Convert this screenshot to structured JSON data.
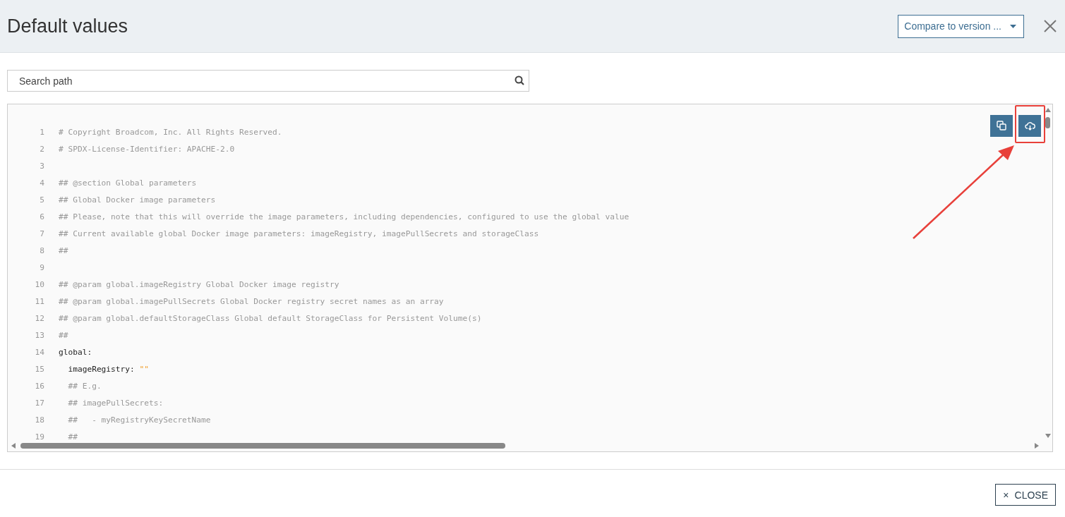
{
  "dialog": {
    "title": "Default values",
    "compare_dropdown": {
      "label": "Compare to version ..."
    }
  },
  "search": {
    "placeholder": "Search path"
  },
  "code_lines": [
    {
      "number": "1",
      "kind": "comment",
      "text": "# Copyright Broadcom, Inc. All Rights Reserved."
    },
    {
      "number": "2",
      "kind": "comment",
      "text": "# SPDX-License-Identifier: APACHE-2.0"
    },
    {
      "number": "3",
      "kind": "blank"
    },
    {
      "number": "4",
      "kind": "comment",
      "text": "## @section Global parameters"
    },
    {
      "number": "5",
      "kind": "comment",
      "text": "## Global Docker image parameters"
    },
    {
      "number": "6",
      "kind": "comment",
      "text": "## Please, note that this will override the image parameters, including dependencies, configured to use the global value"
    },
    {
      "number": "7",
      "kind": "comment",
      "text": "## Current available global Docker image parameters: imageRegistry, imagePullSecrets and storageClass"
    },
    {
      "number": "8",
      "kind": "comment",
      "text": "##"
    },
    {
      "number": "9",
      "kind": "blank"
    },
    {
      "number": "10",
      "kind": "comment",
      "text": "## @param global.imageRegistry Global Docker image registry"
    },
    {
      "number": "11",
      "kind": "comment",
      "text": "## @param global.imagePullSecrets Global Docker registry secret names as an array"
    },
    {
      "number": "12",
      "kind": "comment",
      "text": "## @param global.defaultStorageClass Global default StorageClass for Persistent Volume(s)"
    },
    {
      "number": "13",
      "kind": "comment",
      "text": "##"
    },
    {
      "number": "14",
      "kind": "key",
      "text": "global:"
    },
    {
      "number": "15",
      "kind": "key",
      "text": "  imageRegistry:",
      "value": "\"\""
    },
    {
      "number": "16",
      "kind": "comment",
      "text": "  ## E.g."
    },
    {
      "number": "17",
      "kind": "comment",
      "text": "  ## imagePullSecrets:"
    },
    {
      "number": "18",
      "kind": "comment",
      "text": "  ##   - myRegistryKeySecretName"
    },
    {
      "number": "19",
      "kind": "comment",
      "text": "  ##"
    }
  ],
  "footer": {
    "close_button": {
      "icon": "×",
      "label": "CLOSE"
    }
  }
}
